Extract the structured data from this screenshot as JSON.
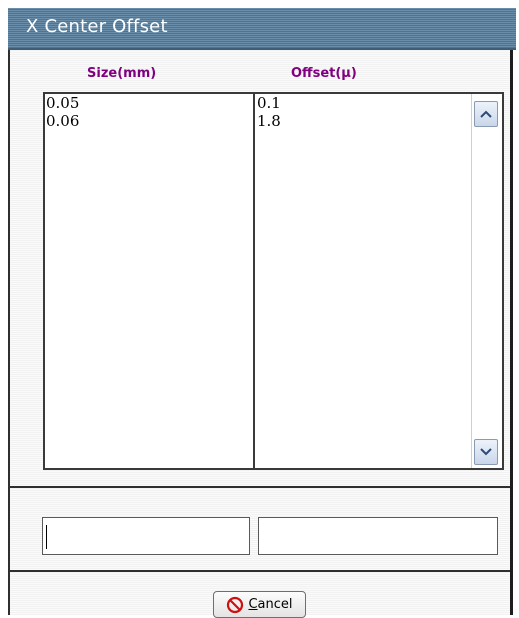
{
  "window": {
    "title": "X Center Offset"
  },
  "table": {
    "columns": [
      "Size(mm)",
      "Offset(µ)"
    ],
    "rows": [
      [
        "0.05",
        "0.1"
      ],
      [
        "0.06",
        "1.8"
      ]
    ]
  },
  "inputs": {
    "size_value": "",
    "offset_value": ""
  },
  "buttons": {
    "cancel_label": "Cancel",
    "cancel_mnemonic": "C",
    "cancel_rest": "ancel"
  },
  "colors": {
    "titlebar": "#5a7e9a",
    "header_text": "#800080"
  },
  "icons": {
    "cancel": "cancel-icon",
    "scroll_up": "chevron-up-icon",
    "scroll_down": "chevron-down-icon"
  }
}
